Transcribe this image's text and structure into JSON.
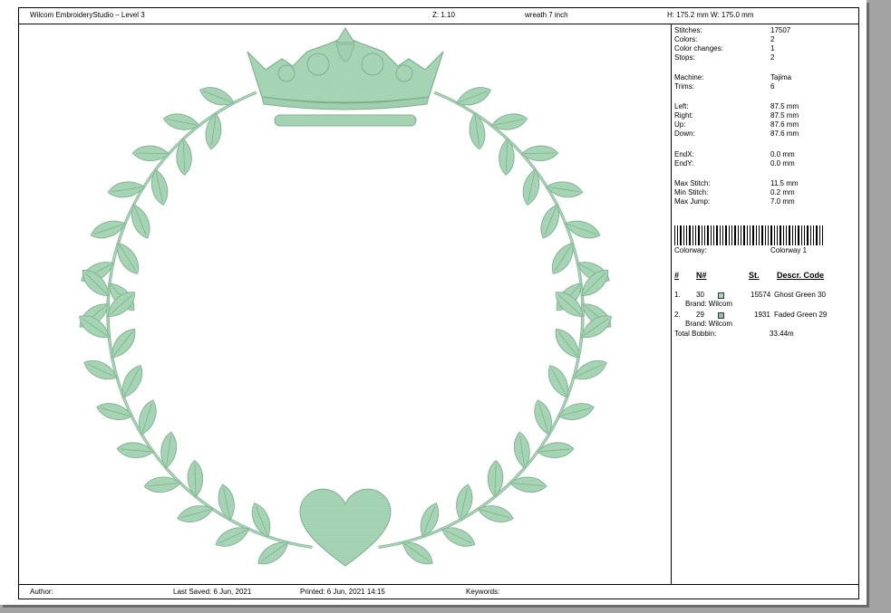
{
  "header": {
    "app": "Wilcom EmbroideryStudio – Level 3",
    "zoom": "Z: 1.10",
    "design_name": "wreath 7 inch",
    "dimensions": "H: 175.2 mm  W: 175.0 mm"
  },
  "stats": [
    {
      "label": "Stitches:",
      "value": "17507"
    },
    {
      "label": "Colors:",
      "value": "2"
    },
    {
      "label": "Color changes:",
      "value": "1"
    },
    {
      "label": "Stops:",
      "value": "2"
    },
    {
      "label": "Machine:",
      "value": "Tajima"
    },
    {
      "label": "Trims:",
      "value": "6"
    },
    {
      "label": "Left:",
      "value": "87.5 mm"
    },
    {
      "label": "Right:",
      "value": "87.5 mm"
    },
    {
      "label": "Up:",
      "value": "87.6 mm"
    },
    {
      "label": "Down:",
      "value": "87.6 mm"
    },
    {
      "label": "EndX:",
      "value": "0.0 mm"
    },
    {
      "label": "EndY:",
      "value": "0.0 mm"
    },
    {
      "label": "Max Stitch:",
      "value": "11.5 mm"
    },
    {
      "label": "Min Stitch:",
      "value": "0.2 mm"
    },
    {
      "label": "Max Jump:",
      "value": "7.0 mm"
    }
  ],
  "colorway": {
    "label": "Colorway:",
    "value": "Colorway 1"
  },
  "columns": {
    "num": "#",
    "n": "N#",
    "st": "St.",
    "desc": "Descr. Code"
  },
  "colors": [
    {
      "idx": "1.",
      "n": "30",
      "swatch": "#a6d6b6",
      "st": "15574",
      "desc": "Ghost Green 30",
      "brand": "Brand: Wilcom"
    },
    {
      "idx": "2.",
      "n": "29",
      "swatch": "#95c2a2",
      "st": "1931",
      "desc": "Faded Green 29",
      "brand": "Brand: Wilcom"
    }
  ],
  "bobbin": {
    "label": "Total Bobbin:",
    "value": "33.44m"
  },
  "footer": {
    "author": "Author:",
    "last_saved": "Last Saved:  6 Jun, 2021",
    "printed": "Printed:  6 Jun, 2021 14:15",
    "keywords": "Keywords:"
  },
  "design_colors": {
    "leaf": "#a6d6b6",
    "leaf_dark": "#7fb08e",
    "crown": "#9fcfae"
  }
}
